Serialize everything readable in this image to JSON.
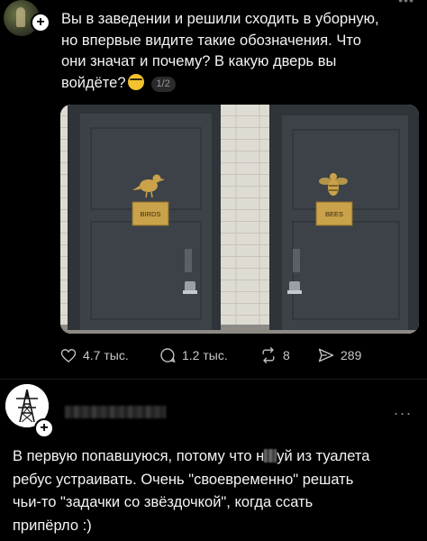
{
  "post": {
    "text_lines": [
      "Вы в заведении и решили сходить в уборную,",
      "но впервые видите такие обозначения. Что",
      "они значат и почему? В какую дверь вы",
      "войдёте?"
    ],
    "emoji_icon": "nerd-face-emoji",
    "page_indicator": "1/2",
    "photo": {
      "door_left_sign": "BIRDS",
      "door_left_icon": "bird-icon",
      "door_right_sign": "BEES",
      "door_right_icon": "bee-icon"
    },
    "actions": {
      "likes": "4.7 тыс.",
      "comments": "1.2 тыс.",
      "reposts": "8",
      "shares": "289"
    }
  },
  "reply": {
    "text_part1": "В первую попавшуюся, потому что н",
    "text_part2": "уй из туалета",
    "text_line2": "ребус устраивать. Очень \"своевременно\" решать",
    "text_line3": "чьи-то \"задачки со звёздочкой\", когда ссать",
    "text_line4": "припёрло :)",
    "more_label": "..."
  },
  "colors": {
    "background": "#000000",
    "text": "#f4f4f4",
    "muted": "#c7c7c7",
    "door": "#3c4248",
    "sign": "#c9a24a"
  }
}
